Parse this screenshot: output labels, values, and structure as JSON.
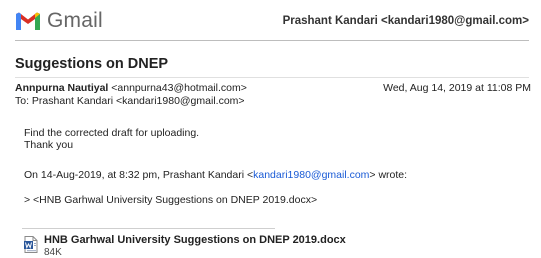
{
  "header": {
    "logo_text": "Gmail",
    "account": "Prashant Kandari <kandari1980@gmail.com>"
  },
  "message": {
    "subject": "Suggestions on DNEP",
    "from_name": "Annpurna Nautiyal",
    "from_email": "<annpurna43@hotmail.com>",
    "date": "Wed, Aug 14, 2019 at 11:08 PM",
    "to": "To: Prashant Kandari <kandari1980@gmail.com>",
    "body_line1": "Find the corrected draft for uploading.",
    "body_line2": "Thank you",
    "quote_prefix": "On 14-Aug-2019, at 8:32 pm, Prashant Kandari <",
    "quote_email": "kandari1980@gmail.com",
    "quote_suffix": "> wrote:",
    "quote_attachment": "> <HNB Garhwal University Suggestions on DNEP 2019.docx>"
  },
  "attachment": {
    "icon": "word-document-icon",
    "name": "HNB Garhwal University Suggestions on DNEP 2019.docx",
    "size": "84K"
  },
  "colors": {
    "gmail_red": "#d93025",
    "link": "#1a5bd6"
  }
}
